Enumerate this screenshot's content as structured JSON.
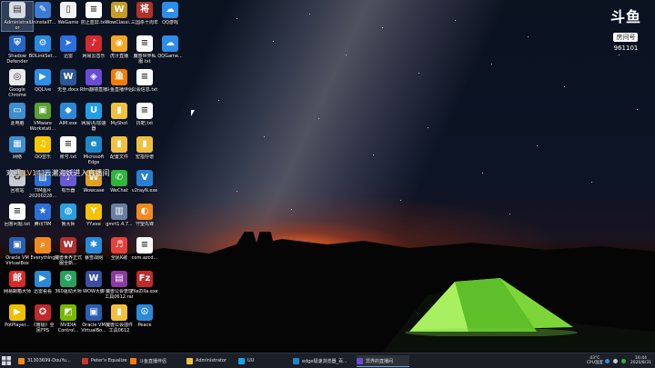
{
  "watermark": {
    "logo": "斗鱼",
    "sub": "房间号",
    "room": "961101"
  },
  "notice": {
    "prefix": "欢迎",
    "level": "[LV14]",
    "text": "云濑海妖进入直播间"
  },
  "icons": [
    {
      "label": "Administrat\nor",
      "color": "#d7dbe2",
      "glyph": "▤",
      "selected": true
    },
    {
      "label": "UninstallT...",
      "color": "#3a7bd5",
      "glyph": "✎"
    },
    {
      "label": "WeGame",
      "color": "#f2f2f2",
      "glyph": "▯"
    },
    {
      "label": "防止蓝屏.txt",
      "color": "#ffffff",
      "glyph": "≡"
    },
    {
      "label": "WowClassi...",
      "color": "#c89a2a",
      "glyph": "W"
    },
    {
      "label": "三国杀十周年",
      "color": "#b0302a",
      "glyph": "将"
    },
    {
      "label": "QQ游戏",
      "color": "#2c8ee8",
      "glyph": "☁"
    },
    {
      "label": "Shadow\nDefender",
      "color": "#2467c5",
      "glyph": "⛨"
    },
    {
      "label": "BDLinkSet...",
      "color": "#2a88e0",
      "glyph": "⚙"
    },
    {
      "label": "迅雷",
      "color": "#2b6fde",
      "glyph": "➤"
    },
    {
      "label": "网易云音乐",
      "color": "#d6282f",
      "glyph": "♪"
    },
    {
      "label": "虎牙直播",
      "color": "#f5a623",
      "glyph": "◉"
    },
    {
      "label": "魔兽世界私\n服.txt",
      "color": "#ffffff",
      "glyph": "≡"
    },
    {
      "label": "QQGame...",
      "color": "#2c8ee8",
      "glyph": "☁"
    },
    {
      "label": "Google\nChrome",
      "color": "#e8eaed",
      "glyph": "◎"
    },
    {
      "label": "QQLive",
      "color": "#2c8ee8",
      "glyph": "▶"
    },
    {
      "label": "无坐.docx",
      "color": "#2b5797",
      "glyph": "W"
    },
    {
      "label": "Rfm翻墙直播",
      "color": "#6a4bd6",
      "glyph": "◈"
    },
    {
      "label": "斗鱼直播伴侣",
      "color": "#f57c00",
      "glyph": "鱼"
    },
    {
      "label": "公会信息.txt",
      "color": "#ffffff",
      "glyph": "≡"
    },
    {
      "label": "此电脑",
      "color": "#3e8ed0",
      "glyph": "▭"
    },
    {
      "label": "VMware\nWorkstati...",
      "color": "#5aa02c",
      "glyph": "▣"
    },
    {
      "label": "AIM.exe",
      "color": "#2b88d8",
      "glyph": "◆"
    },
    {
      "label": "网易UU加速\n器",
      "color": "#20a0e8",
      "glyph": "U"
    },
    {
      "label": "MyShot",
      "color": "#f0c040",
      "glyph": "▮"
    },
    {
      "label": "抖靶.txt",
      "color": "#ffffff",
      "glyph": "≡"
    },
    {
      "label": "网络",
      "color": "#3e8ed0",
      "glyph": "▦"
    },
    {
      "label": "QQ音乐",
      "color": "#f7c600",
      "glyph": "♫"
    },
    {
      "label": "账号.txt",
      "color": "#ffffff",
      "glyph": "≡"
    },
    {
      "label": "Microsoft\nEdge",
      "color": "#1e88c8",
      "glyph": "e"
    },
    {
      "label": "配置文件",
      "color": "#f0c040",
      "glyph": "▮"
    },
    {
      "label": "宏指导谱",
      "color": "#f0c040",
      "glyph": "▮"
    },
    {
      "label": "回收站",
      "color": "#c8ccd2",
      "glyph": "♻"
    },
    {
      "label": "TIM图片\n20200228...",
      "color": "#2c6fd6",
      "glyph": "▧"
    },
    {
      "label": "有乐器",
      "color": "#6a5ad0",
      "glyph": "♩"
    },
    {
      "label": "Wowcase",
      "color": "#e0a020",
      "glyph": "W"
    },
    {
      "label": "WeChat",
      "color": "#2fb43c",
      "glyph": "✆"
    },
    {
      "label": "v2rayN.exe",
      "color": "#2a7fd0",
      "glyph": "V"
    },
    {
      "label": "回答问题.txt",
      "color": "#ffffff",
      "glyph": "≡"
    },
    {
      "label": "腾讯TIM",
      "color": "#2c6fd6",
      "glyph": "★"
    },
    {
      "label": "鲁大师",
      "color": "#2aa0e0",
      "glyph": "◍"
    },
    {
      "label": "YY.exe",
      "color": "#f5c300",
      "glyph": "Y"
    },
    {
      "label": "gmrt1.4.7...",
      "color": "#6a7fa0",
      "glyph": "▥"
    },
    {
      "label": "守望先锋",
      "color": "#f08a1c",
      "glyph": "◐"
    },
    {
      "label": "Oracle VM\nVirtualBox",
      "color": "#2a5fb0",
      "glyph": "▣"
    },
    {
      "label": "Everything",
      "color": "#f08a1c",
      "glyph": "⌕"
    },
    {
      "label": "魔兽世界正式\n服全新...",
      "color": "#b03030",
      "glyph": "W"
    },
    {
      "label": "暴雪战网",
      "color": "#2a8ad8",
      "glyph": "✱"
    },
    {
      "label": "全民K歌",
      "color": "#e8403a",
      "glyph": "♬"
    },
    {
      "label": "com.azcd...",
      "color": "#ffffff",
      "glyph": "≡"
    },
    {
      "label": "网易邮箱大师",
      "color": "#d82a2a",
      "glyph": "邮"
    },
    {
      "label": "迅雷看看",
      "color": "#2a8ad8",
      "glyph": "▶"
    },
    {
      "label": "360驱动大师",
      "color": "#2aa060",
      "glyph": "⚙"
    },
    {
      "label": "WOW大脚",
      "color": "#3a4fa0",
      "glyph": "W"
    },
    {
      "label": "魔兽公会管理\n工具0612.rar",
      "color": "#8a3aa0",
      "glyph": "▤"
    },
    {
      "label": "FileZilla.exe",
      "color": "#c02a2a",
      "glyph": "Fz"
    },
    {
      "label": "PotPlayer...",
      "color": "#f0c000",
      "glyph": "▶"
    },
    {
      "label": "《南极》全\n民FPS",
      "color": "#c02a2a",
      "glyph": "✪"
    },
    {
      "label": "NVIDIA\nControl...",
      "color": "#76b900",
      "glyph": "◩"
    },
    {
      "label": "Oracle VM\nVirtualBo...",
      "color": "#2a5fb0",
      "glyph": "▣"
    },
    {
      "label": "魔兽公会插件\n工具0612",
      "color": "#f0c040",
      "glyph": "▮"
    },
    {
      "label": "Peace",
      "color": "#2a8ad8",
      "glyph": "☮"
    }
  ],
  "taskbar": {
    "items": [
      {
        "label": "31303699-DouYu...",
        "color": "#f08a1c"
      },
      {
        "label": "Peter's Equalizer ...",
        "color": "#c03a2a"
      },
      {
        "label": "斗鱼直播伴侣",
        "color": "#f57c00"
      },
      {
        "label": "Administrator",
        "color": "#f0c040"
      },
      {
        "label": "UU",
        "color": "#20a0e8"
      },
      {
        "label": "edge极速浏览器_百...",
        "color": "#1e88c8"
      },
      {
        "label": "异界的直播间",
        "color": "#6a4bd6",
        "active": true
      }
    ],
    "weather": {
      "temp": "43°C",
      "desc": "CPU温度"
    },
    "clock": {
      "time": "16:44",
      "date": "2020/8/31"
    }
  }
}
